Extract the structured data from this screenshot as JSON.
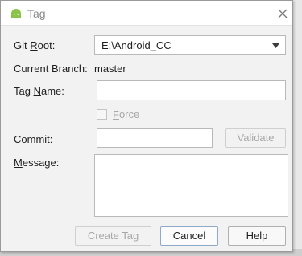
{
  "window": {
    "title": "Tag",
    "icon": "android-icon"
  },
  "form": {
    "git_root": {
      "label_prefix": "Git ",
      "label_underlined": "R",
      "label_suffix": "oot:",
      "value": "E:\\Android_CC"
    },
    "current_branch": {
      "label": "Current Branch:",
      "value": "master"
    },
    "tag_name": {
      "label_prefix": "Tag ",
      "label_underlined": "N",
      "label_suffix": "ame:",
      "value": ""
    },
    "force": {
      "label_underlined": "F",
      "label_suffix": "orce",
      "checked": false,
      "enabled": false
    },
    "commit": {
      "label_underlined": "C",
      "label_suffix": "ommit:",
      "value": ""
    },
    "message": {
      "label_underlined": "M",
      "label_suffix": "essage:",
      "value": ""
    }
  },
  "buttons": {
    "validate": "Validate",
    "create_tag": "Create Tag",
    "cancel": "Cancel",
    "help": "Help"
  },
  "colors": {
    "android_green": "#8bc34a",
    "dialog_bg": "#f2f2f2",
    "disabled_text": "#a8a8a8"
  }
}
